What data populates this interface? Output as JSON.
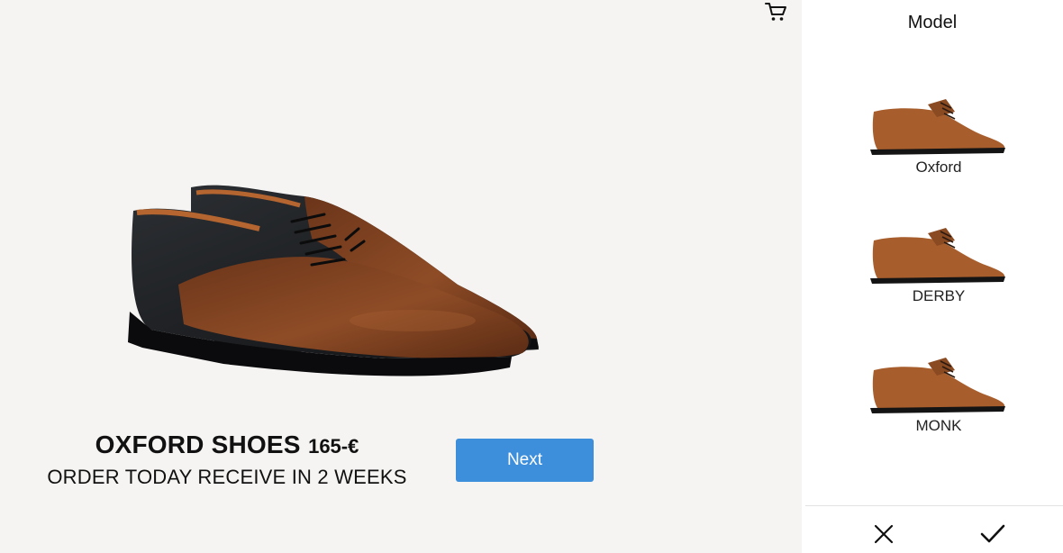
{
  "product": {
    "name": "OXFORD SHOES",
    "price": "165-€",
    "delivery_note": "ORDER TODAY RECEIVE IN 2 WEEKS"
  },
  "actions": {
    "next_label": "Next",
    "cart_icon": "shopping-cart-icon",
    "cancel_icon": "close-icon",
    "confirm_icon": "checkmark-icon"
  },
  "panel": {
    "title": "Model",
    "options": [
      {
        "label": "Oxford"
      },
      {
        "label": "DERBY"
      },
      {
        "label": "MONK"
      }
    ]
  },
  "colors": {
    "accent": "#3d8fdb",
    "background": "#f5f4f2",
    "panel": "#ffffff",
    "leather_brown": "#8a4a25",
    "leather_tan": "#b7682f",
    "leather_black": "#1b1d20"
  }
}
